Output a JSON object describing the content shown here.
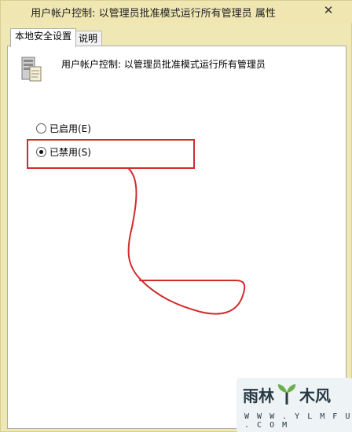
{
  "window": {
    "title": "用户帐户控制: 以管理员批准模式运行所有管理员 属性",
    "close_glyph": "✕"
  },
  "tabs": [
    {
      "label": "本地安全设置",
      "active": true
    },
    {
      "label": "说明",
      "active": false
    }
  ],
  "policy": {
    "name": "用户帐户控制: 以管理员批准模式运行所有管理员",
    "icon": "server-policy-icon"
  },
  "options": [
    {
      "label": "已启用(E)",
      "checked": false
    },
    {
      "label": "已禁用(S)",
      "checked": true
    }
  ],
  "annotation": {
    "color": "#d22b2b"
  },
  "watermark": {
    "left_text": "雨林",
    "right_text": "木风",
    "url": "W W W . Y L M F U . C O M"
  }
}
